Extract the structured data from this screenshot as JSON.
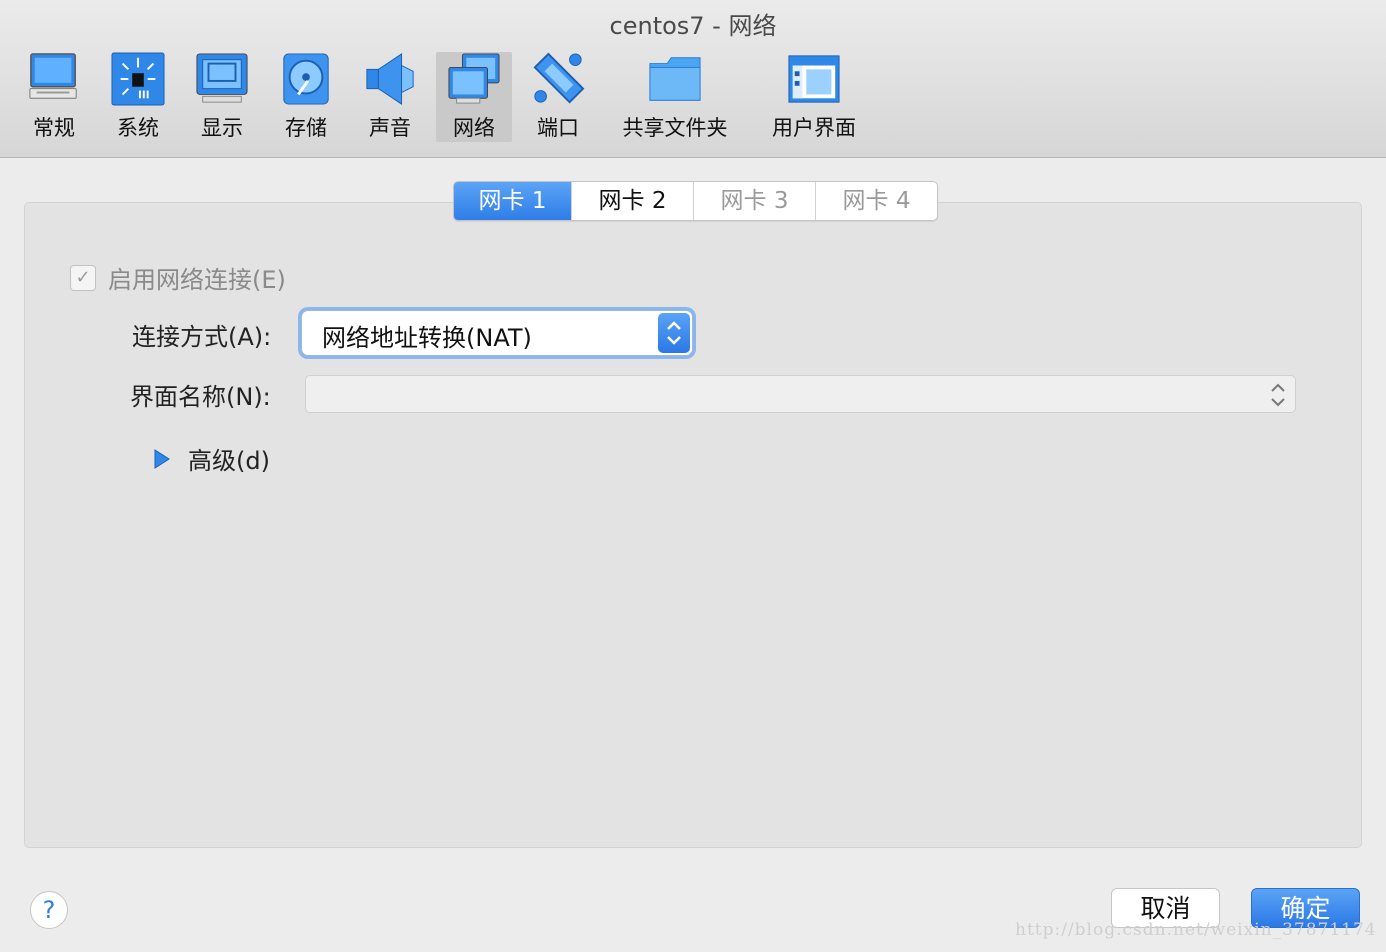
{
  "window": {
    "title": "centos7 - 网络"
  },
  "toolbar": {
    "items": [
      {
        "label": "常规"
      },
      {
        "label": "系统"
      },
      {
        "label": "显示"
      },
      {
        "label": "存储"
      },
      {
        "label": "声音"
      },
      {
        "label": "网络",
        "active": true
      },
      {
        "label": "端口"
      },
      {
        "label": "共享文件夹"
      },
      {
        "label": "用户界面"
      }
    ]
  },
  "tabs": [
    {
      "label": "网卡 1",
      "state": "selected"
    },
    {
      "label": "网卡 2",
      "state": "normal"
    },
    {
      "label": "网卡 3",
      "state": "disabled"
    },
    {
      "label": "网卡 4",
      "state": "disabled"
    }
  ],
  "form": {
    "enable_label": "启用网络连接(E)",
    "enable_checked": true,
    "attach_label": "连接方式(A):",
    "attach_value": "网络地址转换(NAT)",
    "iface_label": "界面名称(N):",
    "iface_value": "",
    "advanced_label": "高级(d)"
  },
  "buttons": {
    "help": "?",
    "cancel": "取消",
    "ok": "确定"
  },
  "watermark": "http://blog.csdn.net/weixin_37871174",
  "colors": {
    "accent": "#2f7de8",
    "panel": "#e3e3e3"
  }
}
